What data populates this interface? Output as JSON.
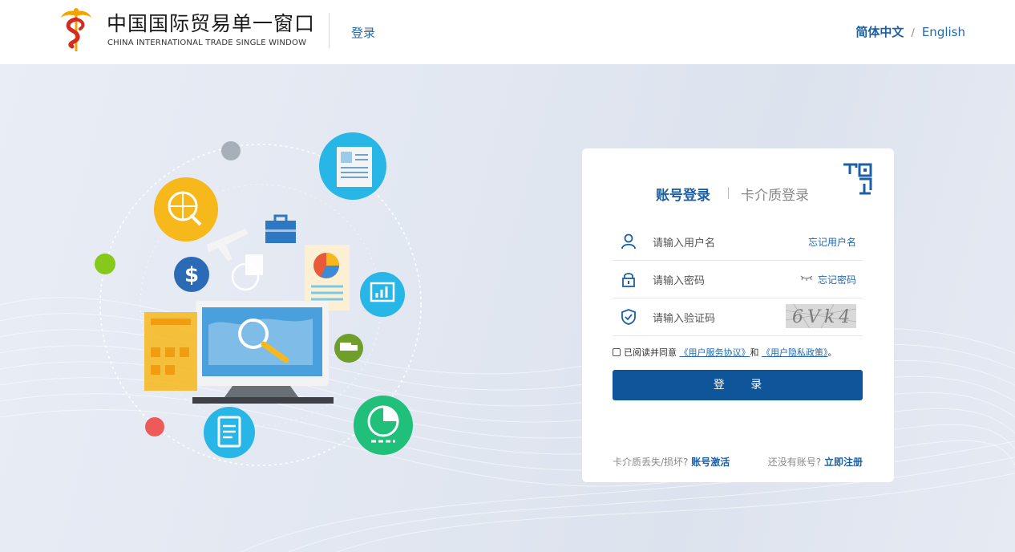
{
  "header": {
    "brand_cn": "中国国际贸易单一窗口",
    "brand_en": "CHINA INTERNATIONAL TRADE SINGLE WINDOW",
    "login_link": "登录",
    "lang_zh": "简体中文",
    "lang_sep": "/",
    "lang_en": "English"
  },
  "login": {
    "tab_account": "账号登录",
    "tab_card": "卡介质登录",
    "username_placeholder": "请输入用户名",
    "forgot_username": "忘记用户名",
    "password_placeholder": "请输入密码",
    "forgot_password": "忘记密码",
    "captcha_placeholder": "请输入验证码",
    "captcha_text": "6Vk4",
    "agree_prefix": "已阅读并同意",
    "agree_terms": "《用户服务协议》",
    "agree_and": "和",
    "agree_privacy": "《用户隐私政策》",
    "agree_end": "。",
    "submit": "登  录",
    "card_lost_prefix": "卡介质丢失/损坏?",
    "card_lost_link": "账号激活",
    "no_account_prefix": "还没有账号?",
    "register_link": "立即注册"
  },
  "colors": {
    "brand_blue": "#1d5fa5",
    "button_blue": "#0e5599",
    "link_blue": "#2468b0"
  },
  "icons": [
    "logo-icon",
    "qr-code-icon",
    "user-icon",
    "lock-icon",
    "eye-closed-icon",
    "shield-check-icon"
  ]
}
